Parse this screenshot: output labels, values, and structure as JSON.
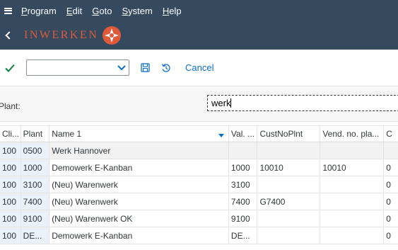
{
  "menubar": {
    "items": [
      {
        "label": "Program"
      },
      {
        "label": "Edit"
      },
      {
        "label": "Goto"
      },
      {
        "label": "System"
      },
      {
        "label": "Help"
      }
    ]
  },
  "titlebar": {
    "logo_text": "INWERKEN",
    "logo_color": "#e05a3a"
  },
  "toolbar": {
    "dropdown_value": "",
    "cancel_label": "Cancel"
  },
  "selection": {
    "plant_label": "Plant:",
    "search_value": "werk"
  },
  "table": {
    "headers": [
      "Cli...",
      "Plant",
      "Name 1",
      "Val. ...",
      "CustNoPlnt",
      "Vend. no. pla...",
      "C"
    ],
    "rows": [
      [
        "100",
        "0500",
        "Werk Hannover",
        "",
        "",
        "",
        ""
      ],
      [
        "100",
        "1000",
        "Demowerk E-Kanban",
        "1000",
        "10010",
        "10010",
        "0"
      ],
      [
        "100",
        "3100",
        "(Neu) Warenwerk",
        "3100",
        "",
        "",
        "0"
      ],
      [
        "100",
        "7400",
        "(Neu) Warenwerk",
        "7400",
        "G7400",
        "",
        "0"
      ],
      [
        "100",
        "9100",
        "(Neu) Warenwerk OK",
        "9100",
        "",
        "",
        "0"
      ],
      [
        "100",
        "DE...",
        "Demowerk E-Kanban",
        "DE...",
        "",
        "",
        "0"
      ]
    ]
  },
  "colors": {
    "shell_bg": "#354a5f",
    "accent_blue": "#0a6ed1",
    "check_green": "#107e3e"
  }
}
